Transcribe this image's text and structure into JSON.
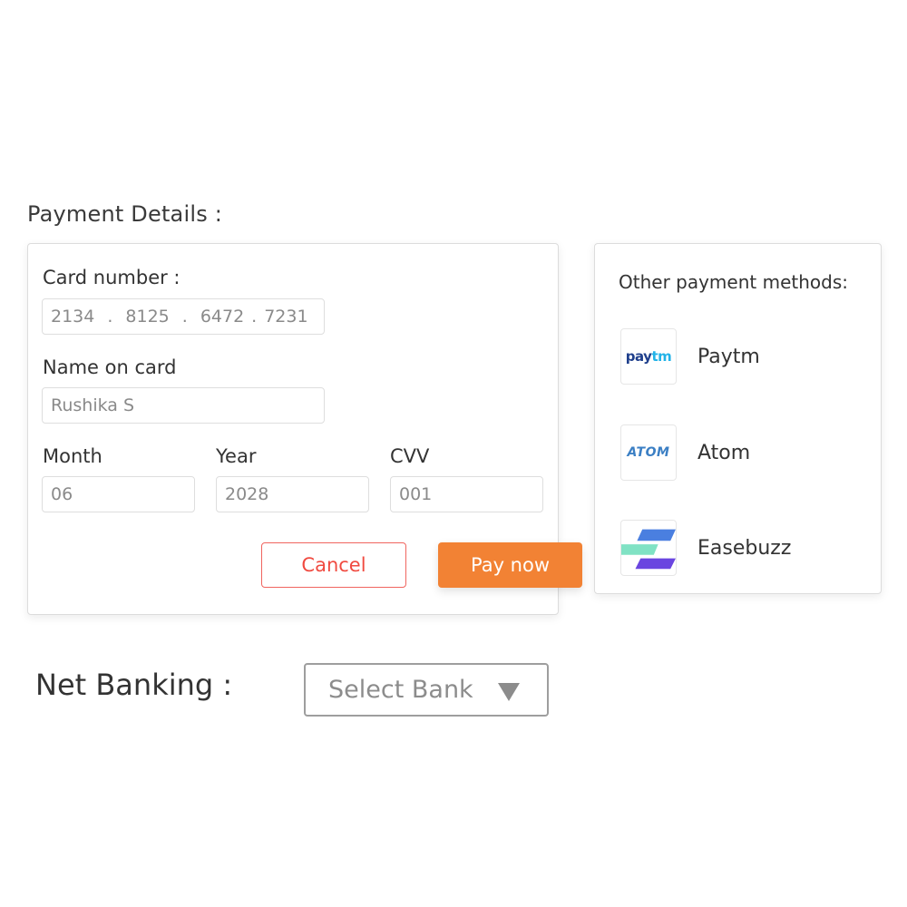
{
  "payment_details": {
    "title": "Payment Details :",
    "card_number": {
      "label": "Card number :",
      "segments": [
        "2134",
        "8125",
        "6472",
        "7231"
      ],
      "separator": "."
    },
    "name_on_card": {
      "label": "Name on card",
      "value": "Rushika S"
    },
    "month": {
      "label": "Month",
      "value": "06"
    },
    "year": {
      "label": "Year",
      "value": "2028"
    },
    "cvv": {
      "label": "CVV",
      "value": "001"
    },
    "cancel_label": "Cancel",
    "pay_label": "Pay now",
    "colors": {
      "pay": "#f28234",
      "cancel": "#f04a40"
    }
  },
  "other_methods": {
    "title": "Other payment methods:",
    "items": [
      {
        "label": "Paytm",
        "icon": "paytm-logo-icon",
        "logo_text_a": "pay",
        "logo_text_b": "tm"
      },
      {
        "label": "Atom",
        "icon": "atom-logo-icon",
        "logo_text": "ATOM"
      },
      {
        "label": "Easebuzz",
        "icon": "easebuzz-logo-icon"
      }
    ]
  },
  "net_banking": {
    "label": "Net Banking :",
    "select_placeholder": "Select Bank",
    "caret_icon": "caret-down-icon"
  }
}
